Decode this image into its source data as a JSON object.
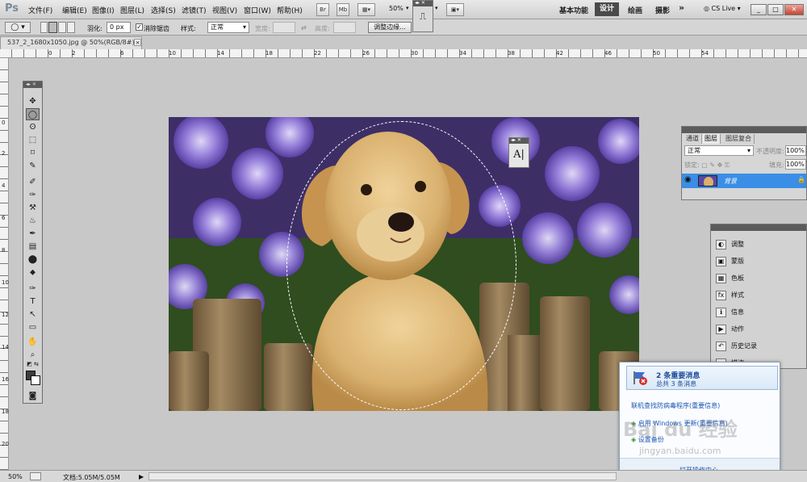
{
  "app": {
    "logo": "Ps"
  },
  "menu": [
    "文件(F)",
    "编辑(E)",
    "图像(I)",
    "图层(L)",
    "选择(S)",
    "滤镜(T)",
    "视图(V)",
    "窗口(W)",
    "帮助(H)"
  ],
  "toolbar": {
    "btn_br": "Br",
    "btn_mb": "Mb",
    "zoom": "50%"
  },
  "workspace": {
    "basic": "基本功能",
    "design": "设计",
    "painting": "绘画",
    "photography": "摄影",
    "more": "»",
    "cs_live": "CS Live"
  },
  "window_buttons": {
    "minimize": "_",
    "restore": "□",
    "close": "✕"
  },
  "options": {
    "feather_label": "羽化:",
    "feather_value": "0 px",
    "antialias_label": "消除锯齿",
    "antialias_checked": true,
    "style_label": "样式:",
    "style_value": "正常",
    "width_label": "宽度:",
    "height_label": "高度:",
    "refine_edge": "调整边缘..."
  },
  "document": {
    "tab_title": "537_2_1680x1050.jpg @ 50%(RGB/8#) *",
    "close": "×"
  },
  "ruler_h_labels": [
    "0",
    "2",
    "4",
    "6",
    "8",
    "10",
    "12",
    "14",
    "16",
    "18",
    "20",
    "22",
    "24",
    "26",
    "28",
    "30",
    "32",
    "34",
    "36",
    "38",
    "40",
    "42",
    "44",
    "46",
    "48",
    "50",
    "52",
    "54"
  ],
  "ruler_v_labels": [
    "0",
    "2",
    "4",
    "6",
    "8",
    "10",
    "12",
    "14",
    "16",
    "18",
    "20",
    "22",
    "24",
    "26"
  ],
  "tools": [
    "✥",
    "◯",
    "ʘ",
    "⬚",
    "⌑",
    "✎",
    "✐",
    "✑",
    "⚒",
    "♨",
    "✒",
    "▤",
    "⬤",
    "⬥",
    "✑",
    "T",
    "↖",
    "▭",
    "✋",
    "⌕"
  ],
  "char_panel": {
    "icon": "A|"
  },
  "layers_panel": {
    "tabs": [
      "通道",
      "图层",
      "图层复合"
    ],
    "active_tab": "图层",
    "blend_mode": "正常",
    "opacity_label": "不透明度:",
    "opacity": "100%",
    "lock_label": "锁定:",
    "fill_label": "填充:",
    "fill": "100%",
    "layers": [
      {
        "name": "背景",
        "visible": true,
        "locked": true
      }
    ]
  },
  "adjust_panel": {
    "items": [
      {
        "icon": "◐",
        "label": "调整"
      },
      {
        "icon": "▣",
        "label": "蒙版"
      },
      {
        "icon": "▦",
        "label": "色板"
      },
      {
        "icon": "fx",
        "label": "样式"
      },
      {
        "icon": "ℹ",
        "label": "信息"
      },
      {
        "icon": "▶",
        "label": "动作"
      },
      {
        "icon": "↶",
        "label": "历史记录"
      },
      {
        "icon": "≈",
        "label": "描边"
      }
    ]
  },
  "notification": {
    "title": "2 条重要消息",
    "subtitle": "总共 3 条消息",
    "link1": "联机查找防病毒程序(重要信息)",
    "link2": "启用 Windows 更新(重要信息)",
    "link3": "设置备份",
    "open": "打开操作中心"
  },
  "watermark": {
    "main": "Bai du 经验",
    "url": "jingyan.baidu.com"
  },
  "status": {
    "zoom": "50%",
    "doc": "文档:5.05M/5.05M"
  }
}
